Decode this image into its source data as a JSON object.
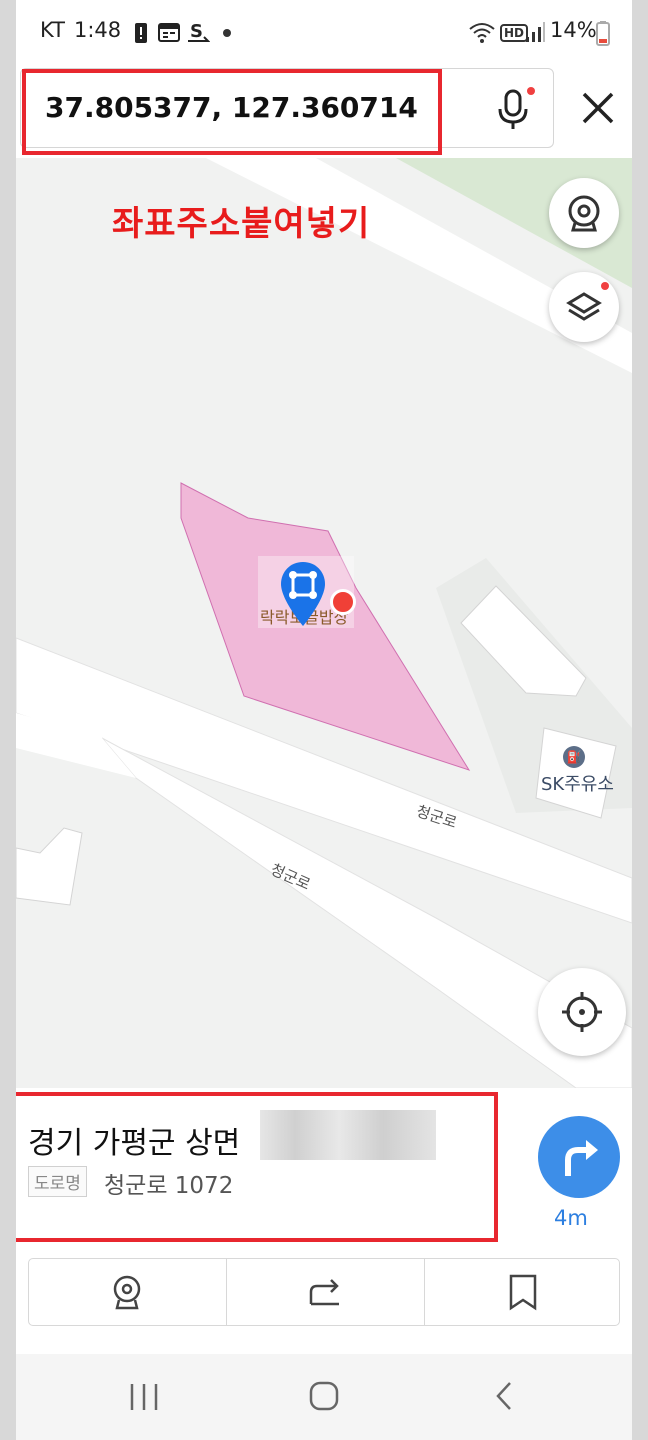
{
  "status_bar": {
    "carrier": "KT",
    "time": "1:48",
    "battery": "14%",
    "hd_label": "HD",
    "icons": [
      "alert-icon",
      "calendar-icon",
      "s-app-icon",
      "dot-icon",
      "wifi-icon",
      "hd-icon",
      "signal-icon",
      "battery-icon"
    ]
  },
  "search": {
    "value": "37.805377, 127.360714",
    "mic_icon": "microphone-icon",
    "close_icon": "close-icon"
  },
  "annotation": {
    "caption": "좌표주소붙여넣기",
    "highlight_color": "#e8272f"
  },
  "map": {
    "poi_label": "락락보글밥상",
    "gas_station": "SK주유소",
    "road_label_1": "청군로",
    "road_label_2": "청군로",
    "parcel_color": "#f0b8d8",
    "pin_color": "#1a73e8",
    "buttons": [
      "cctv-icon",
      "layers-icon",
      "my-location-icon"
    ]
  },
  "place": {
    "address": "경기 가평군 상면",
    "road_badge": "도로명",
    "road_address": "청군로 1072",
    "distance": "4m",
    "route_color": "#3d8ee8"
  },
  "actions": [
    "cctv-icon",
    "share-icon",
    "bookmark-icon"
  ],
  "nav": [
    "recent-apps-icon",
    "home-icon",
    "back-icon"
  ]
}
